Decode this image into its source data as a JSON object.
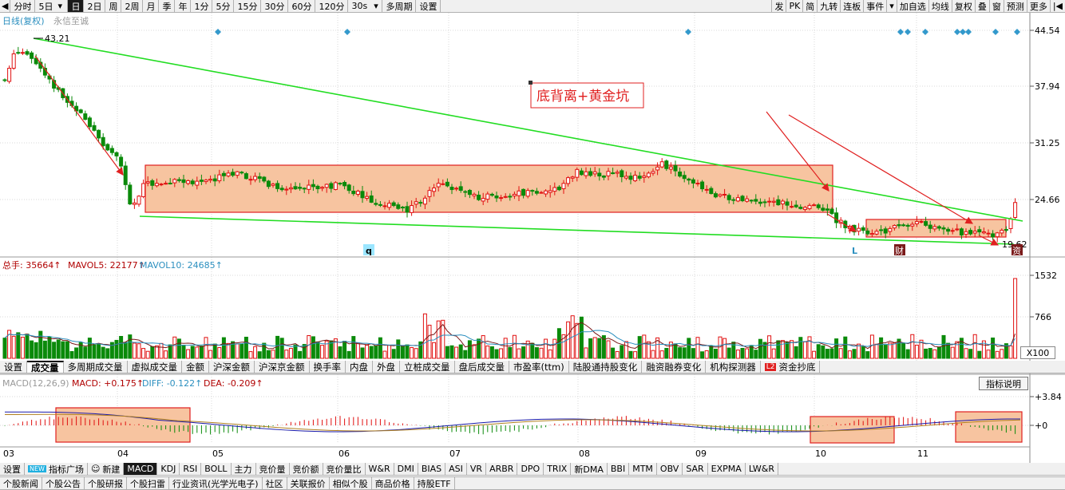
{
  "top_toolbar": {
    "items": [
      "分时",
      "5日",
      "日",
      "2日",
      "周",
      "2周",
      "月",
      "季",
      "年",
      "1分",
      "5分",
      "15分",
      "30分",
      "60分",
      "120分",
      "30s",
      "多周期",
      "设置"
    ],
    "selected": "日",
    "right_items": [
      "发",
      "PK",
      "简",
      "九转",
      "连板",
      "事件",
      "加自选",
      "均线",
      "复权",
      "叠",
      "窗",
      "预测",
      "更多"
    ]
  },
  "main_chart": {
    "title": "日线(复权)",
    "stock_name": "永信至诚",
    "price_axis": [
      "44.54",
      "37.94",
      "31.25",
      "24.66"
    ],
    "high_label": "43.21",
    "low_label": "19.62",
    "annotation": "底背离+黄金坑",
    "markers": [
      "q",
      "L",
      "财",
      "资"
    ]
  },
  "volume_panel": {
    "header": {
      "total": "总手: 35664↑",
      "mavol5": "MAVOL5: 22177↑",
      "mavol10": "MAVOL10: 24685↑"
    },
    "axis": [
      "1532",
      "766"
    ],
    "unit": "X100"
  },
  "indicator_tabs": [
    "设置",
    "成交量",
    "多周期成交量",
    "虚拟成交量",
    "金额",
    "沪深金额",
    "沪深京金额",
    "换手率",
    "内盘",
    "外盘",
    "立桩成交量",
    "盘后成交量",
    "市盈率(ttm)",
    "陆股通持股变化",
    "融资融券变化",
    "机构探测器",
    "资金抄底"
  ],
  "indicator_selected": "成交量",
  "indicator_help": "指标说明",
  "macd_panel": {
    "header": {
      "name": "MACD(12,26,9)",
      "macd": "MACD: +0.175↑",
      "diff": "DIFF: -0.122↑",
      "dea": "DEA: -0.209↑"
    },
    "axis": [
      "+3.84",
      "+0"
    ]
  },
  "time_axis": [
    "03",
    "04",
    "05",
    "06",
    "07",
    "08",
    "09",
    "10",
    "11"
  ],
  "macd_tabs": {
    "items": [
      "设置",
      "NEW",
      "指标广场",
      "新建",
      "MACD",
      "KDJ",
      "RSI",
      "BOLL",
      "主力",
      "竞价量",
      "竞价额",
      "竞价量比",
      "W&R",
      "DMI",
      "BIAS",
      "ASI",
      "VR",
      "ARBR",
      "DPO",
      "TRIX",
      "新DMA",
      "BBI",
      "MTM",
      "OBV",
      "SAR",
      "EXPMA",
      "LW&R"
    ],
    "selected": "MACD"
  },
  "news_tabs": [
    "个股新闻",
    "个股公告",
    "个股研报",
    "个股扫雷",
    "行业资讯(光学光电子)",
    "社区",
    "关联报价",
    "相似个股",
    "商品价格",
    "持股ETF"
  ],
  "colors": {
    "up": "#e01010",
    "down": "#0a8a0a",
    "trend": "#22dd22",
    "box": "#f7c4a0",
    "boxborder": "#e02020",
    "macd_line": "#1a1aaa"
  }
}
